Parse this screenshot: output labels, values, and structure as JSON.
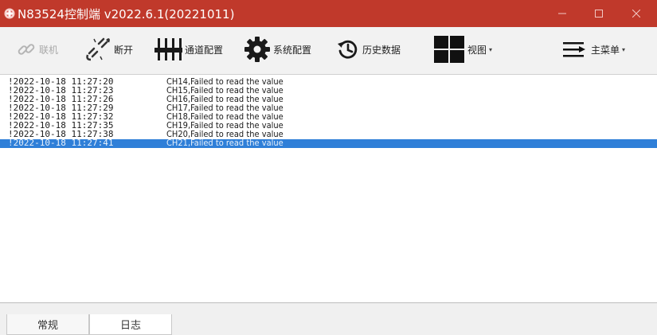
{
  "window": {
    "title": "N83524控制端 v2022.6.1(20221011)",
    "titlebar_color": "#c0392b",
    "controls": [
      "minimize-icon",
      "maximize-icon",
      "close-icon"
    ]
  },
  "toolbar": {
    "items": [
      {
        "label": "联机",
        "icon": "link-icon",
        "enabled": false
      },
      {
        "label": "断开",
        "icon": "broken-link-icon",
        "enabled": true
      },
      {
        "label": "通道配置",
        "icon": "sliders-icon",
        "enabled": true
      },
      {
        "label": "系统配置",
        "icon": "gear-icon",
        "enabled": true
      },
      {
        "label": "历史数据",
        "icon": "history-icon",
        "enabled": true
      },
      {
        "label": "视图",
        "icon": "grid-view-icon",
        "enabled": true,
        "dropdown": true
      },
      {
        "label": "主菜单",
        "icon": "menu-icon",
        "enabled": true,
        "dropdown": true
      }
    ]
  },
  "log": {
    "selected_color": "#2f7fd8",
    "entries": [
      {
        "time": "!2022-10-18 11:27:20",
        "message": "CH14,Failed to read the value"
      },
      {
        "time": "!2022-10-18 11:27:23",
        "message": "CH15,Failed to read the value"
      },
      {
        "time": "!2022-10-18 11:27:26",
        "message": "CH16,Failed to read the value"
      },
      {
        "time": "!2022-10-18 11:27:29",
        "message": "CH17,Failed to read the value"
      },
      {
        "time": "!2022-10-18 11:27:32",
        "message": "CH18,Failed to read the value"
      },
      {
        "time": "!2022-10-18 11:27:35",
        "message": "CH19,Failed to read the value"
      },
      {
        "time": "!2022-10-18 11:27:38",
        "message": "CH20,Failed to read the value"
      },
      {
        "time": "!2022-10-18 11:27:41",
        "message": "CH21,Failed to read the value",
        "selected": true
      }
    ]
  },
  "tabs": [
    {
      "label": "常规",
      "active": false
    },
    {
      "label": "日志",
      "active": true
    }
  ]
}
